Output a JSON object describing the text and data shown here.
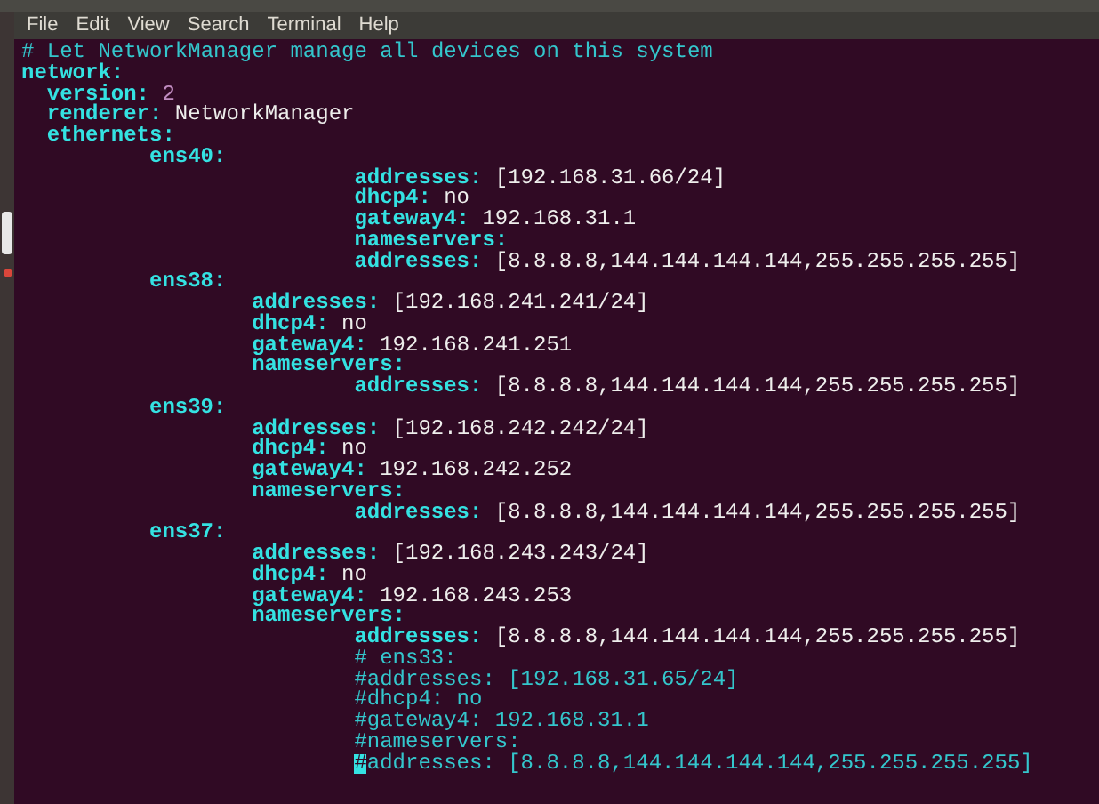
{
  "menu": [
    "File",
    "Edit",
    "View",
    "Search",
    "Terminal",
    "Help"
  ],
  "lines": [
    {
      "kind": "comment",
      "text": "# Let NetworkManager manage all devices on this system"
    },
    {
      "kind": "section",
      "key": "network:",
      "children": [
        {
          "kind": "number",
          "key": "version:",
          "value": "2"
        },
        {
          "kind": "pair",
          "key": "renderer:",
          "value": "NetworkManager"
        },
        {
          "kind": "section",
          "key": "ethernets:",
          "children": [
            {
              "kind": "wide_section",
              "key": "ens40:",
              "children": [
                {
                  "kind": "pair",
                  "key": "addresses:",
                  "value": "[192.168.31.66/24]"
                },
                {
                  "kind": "pair",
                  "key": "dhcp4:",
                  "value": "no"
                },
                {
                  "kind": "pair",
                  "key": "gateway4:",
                  "value": "192.168.31.1"
                },
                {
                  "kind": "section",
                  "key": "nameservers:",
                  "children": [
                    {
                      "kind": "pair",
                      "key": "addresses:",
                      "value": "[8.8.8.8,144.144.144.144,255.255.255.255]"
                    }
                  ]
                }
              ]
            },
            {
              "kind": "section",
              "key": "ens38:",
              "children": [
                {
                  "kind": "pair",
                  "key": "addresses:",
                  "value": "[192.168.241.241/24]"
                },
                {
                  "kind": "pair",
                  "key": "dhcp4:",
                  "value": "no"
                },
                {
                  "kind": "pair",
                  "key": "gateway4:",
                  "value": "192.168.241.251"
                },
                {
                  "kind": "section",
                  "key": "nameservers:",
                  "children": [
                    {
                      "kind": "pair",
                      "key": "addresses:",
                      "value": "[8.8.8.8,144.144.144.144,255.255.255.255]"
                    }
                  ]
                }
              ]
            },
            {
              "kind": "section",
              "key": "ens39:",
              "children": [
                {
                  "kind": "pair",
                  "key": "addresses:",
                  "value": "[192.168.242.242/24]"
                },
                {
                  "kind": "pair",
                  "key": "dhcp4:",
                  "value": "no"
                },
                {
                  "kind": "pair",
                  "key": "gateway4:",
                  "value": "192.168.242.252"
                },
                {
                  "kind": "section",
                  "key": "nameservers:",
                  "children": [
                    {
                      "kind": "pair",
                      "key": "addresses:",
                      "value": "[8.8.8.8,144.144.144.144,255.255.255.255]"
                    }
                  ]
                }
              ]
            },
            {
              "kind": "section",
              "key": "ens37:",
              "children": [
                {
                  "kind": "pair",
                  "key": "addresses:",
                  "value": "[192.168.243.243/24]"
                },
                {
                  "kind": "pair",
                  "key": "dhcp4:",
                  "value": "no"
                },
                {
                  "kind": "pair",
                  "key": "gateway4:",
                  "value": "192.168.243.253"
                },
                {
                  "kind": "section",
                  "key": "nameservers:",
                  "children": [
                    {
                      "kind": "pair",
                      "key": "addresses:",
                      "value": "[8.8.8.8,144.144.144.144,255.255.255.255]"
                    },
                    {
                      "kind": "comment",
                      "text": "# ens33:"
                    },
                    {
                      "kind": "comment",
                      "text": "#addresses: [192.168.31.65/24]"
                    },
                    {
                      "kind": "comment",
                      "text": "#dhcp4: no"
                    },
                    {
                      "kind": "comment",
                      "text": "#gateway4: 192.168.31.1"
                    },
                    {
                      "kind": "comment",
                      "text": "#nameservers:"
                    },
                    {
                      "kind": "comment",
                      "text": "#addresses: [8.8.8.8,144.144.144.144,255.255.255.255]",
                      "cursor": true
                    }
                  ]
                }
              ]
            }
          ]
        }
      ]
    }
  ]
}
